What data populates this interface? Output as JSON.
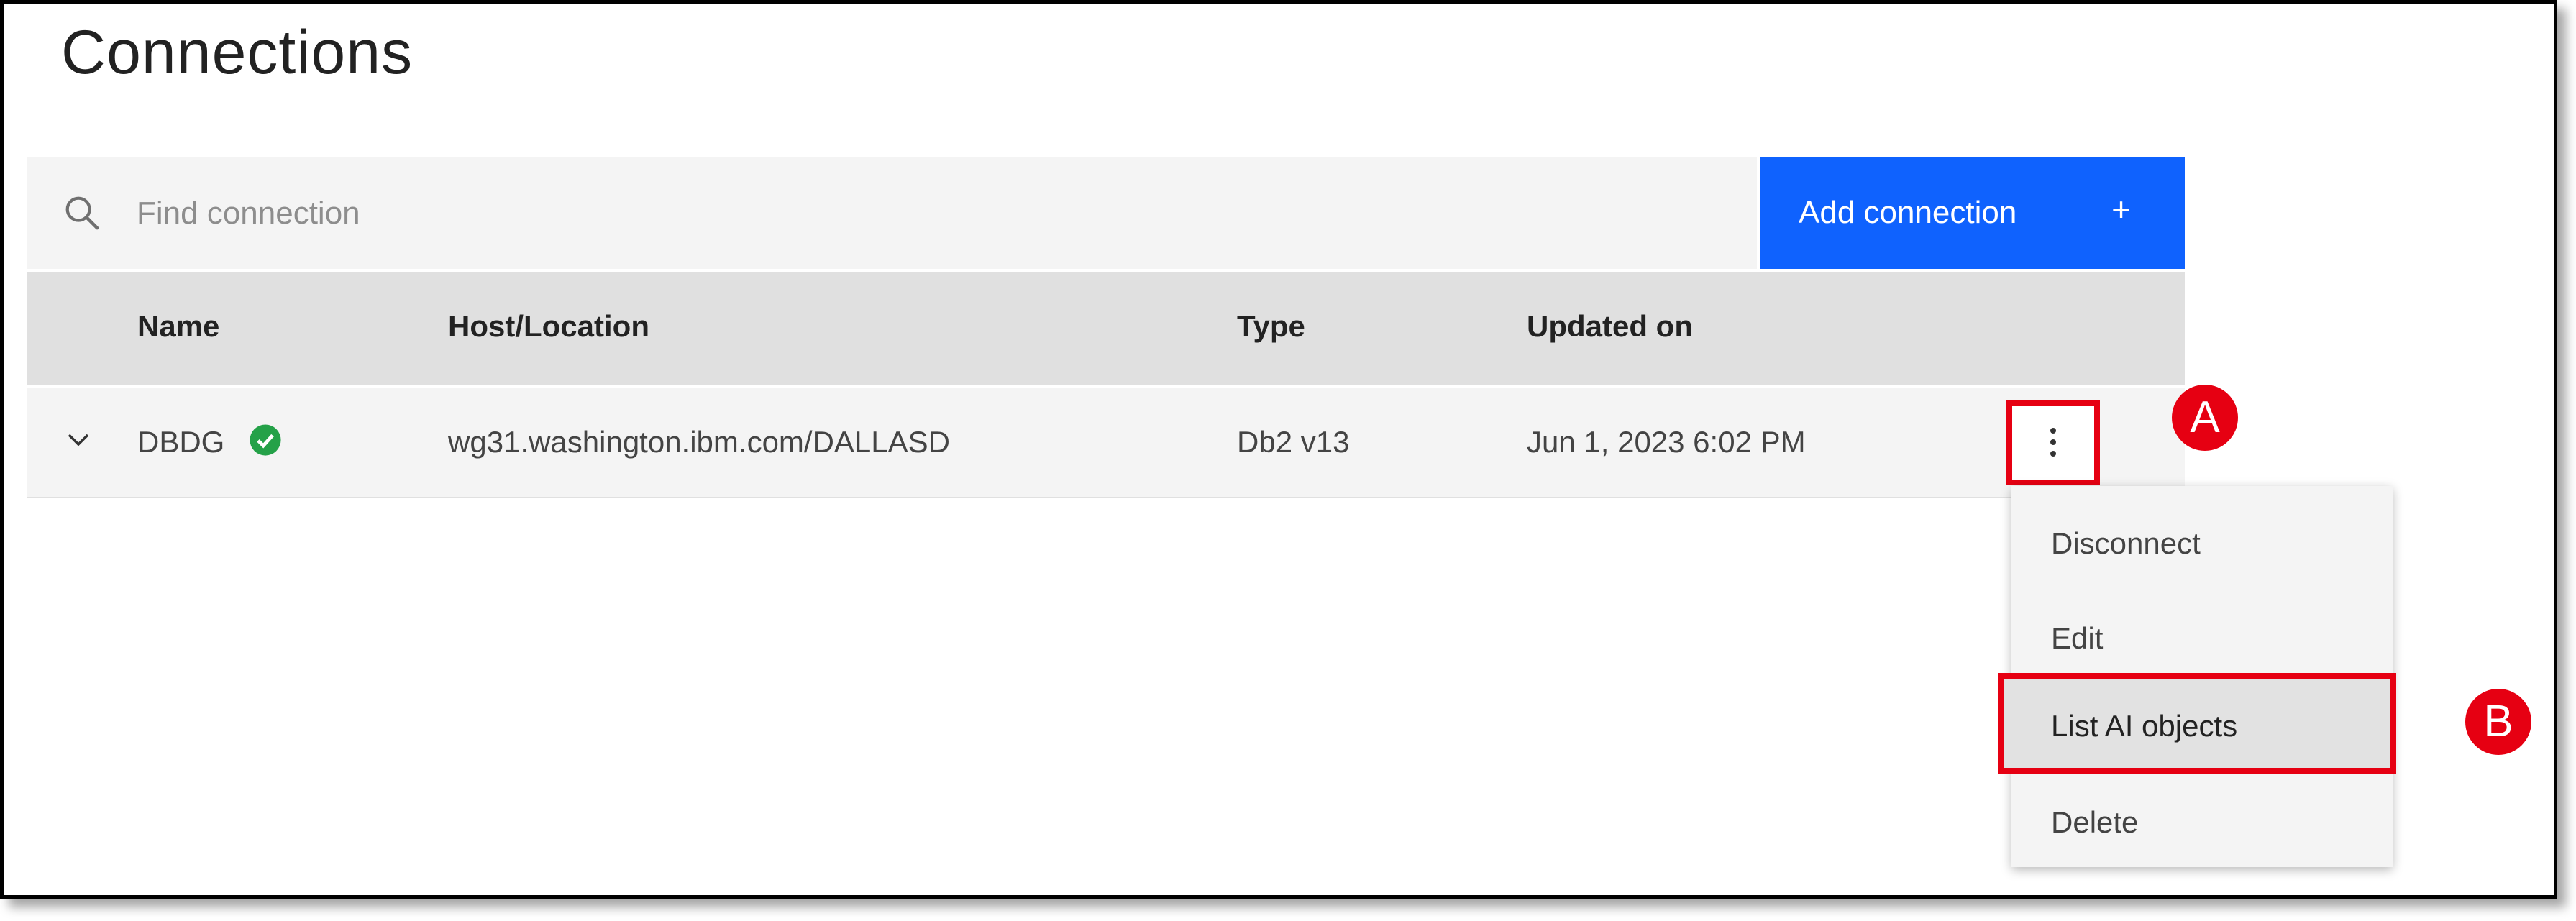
{
  "page": {
    "title": "Connections"
  },
  "search": {
    "placeholder": "Find connection",
    "value": ""
  },
  "toolbar": {
    "add_label": "Add connection",
    "add_icon": "+"
  },
  "table": {
    "columns": [
      "Name",
      "Host/Location",
      "Type",
      "Updated on"
    ],
    "rows": [
      {
        "name": "DBDG",
        "status": "connected",
        "host": "wg31.washington.ibm.com/DALLASD",
        "type": "Db2 v13",
        "updated": "Jun 1, 2023 6:02 PM"
      }
    ]
  },
  "menu": {
    "items": [
      "Disconnect",
      "Edit",
      "List AI objects",
      "Delete"
    ],
    "highlighted": "List AI objects"
  },
  "callouts": {
    "a": "A",
    "b": "B"
  },
  "colors": {
    "accent": "#0f62fe",
    "annotation": "#e60012",
    "success": "#24a148",
    "header_bg": "#e0e0e0",
    "row_bg": "#f4f4f4"
  },
  "icons": {
    "search": "search-icon",
    "add": "plus-icon",
    "expand": "chevron-down-icon",
    "status": "checkmark-circle-icon",
    "overflow": "overflow-menu-icon"
  }
}
